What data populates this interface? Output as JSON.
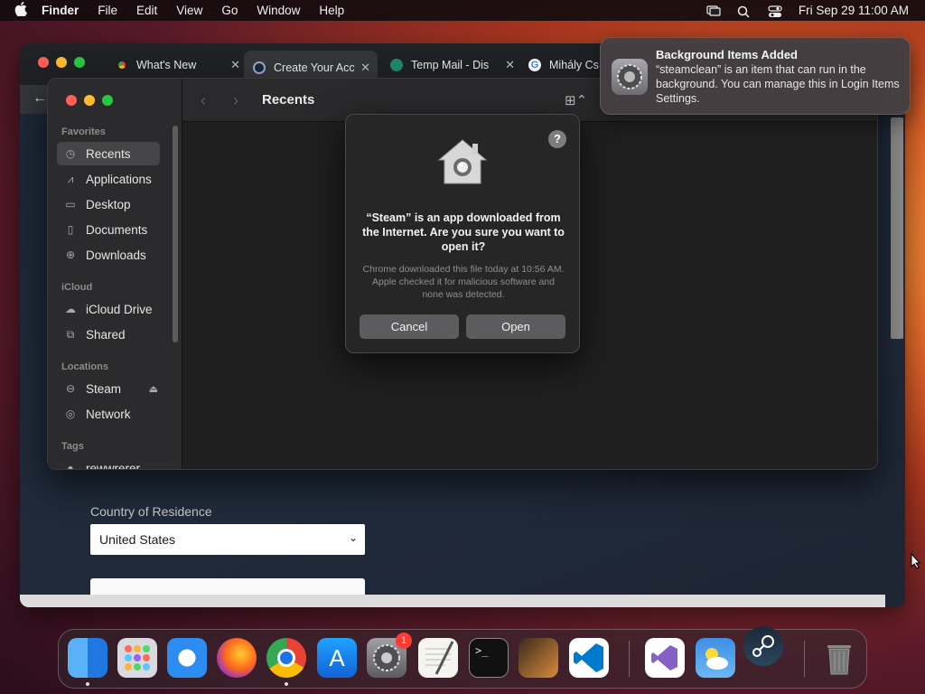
{
  "menubar": {
    "app_name": "Finder",
    "items": [
      "File",
      "Edit",
      "View",
      "Go",
      "Window",
      "Help"
    ],
    "datetime": "Fri Sep 29  11:00 AM"
  },
  "chrome": {
    "tabs": [
      {
        "label": "What's New",
        "icon": "chrome-icon"
      },
      {
        "label": "Create Your Acc",
        "icon": "steam-icon"
      },
      {
        "label": "Temp Mail - Dis",
        "icon": "tempmail-icon"
      },
      {
        "label": "Mihály Cs",
        "icon": "google-icon"
      }
    ],
    "page": {
      "country_label": "Country of Residence",
      "country_value": "United States"
    }
  },
  "finder": {
    "title": "Recents",
    "sections": {
      "favorites": "Favorites",
      "icloud": "iCloud",
      "locations": "Locations",
      "tags": "Tags"
    },
    "favorites": [
      "Recents",
      "Applications",
      "Desktop",
      "Documents",
      "Downloads"
    ],
    "icloud": [
      "iCloud Drive",
      "Shared"
    ],
    "locations": [
      "Steam",
      "Network"
    ],
    "tags": [
      "rewwrerer"
    ]
  },
  "dialog": {
    "help": "?",
    "title": "“Steam” is an app downloaded from the Internet. Are you sure you want to open it?",
    "subtitle": "Chrome downloaded this file today at 10:56 AM. Apple checked it for malicious software and none was detected.",
    "cancel": "Cancel",
    "open": "Open"
  },
  "notification": {
    "title": "Background Items Added",
    "body": "“steamclean” is an item that can run in the background. You can manage this in Login Items Settings."
  },
  "dock": {
    "apps": [
      "finder",
      "launchpad",
      "safari",
      "firefox",
      "chrome",
      "app-store",
      "system-settings",
      "textedit",
      "terminal",
      "garageband",
      "vscode",
      "visual-studio",
      "weather",
      "steam",
      "trash"
    ],
    "settings_badge": "1"
  }
}
